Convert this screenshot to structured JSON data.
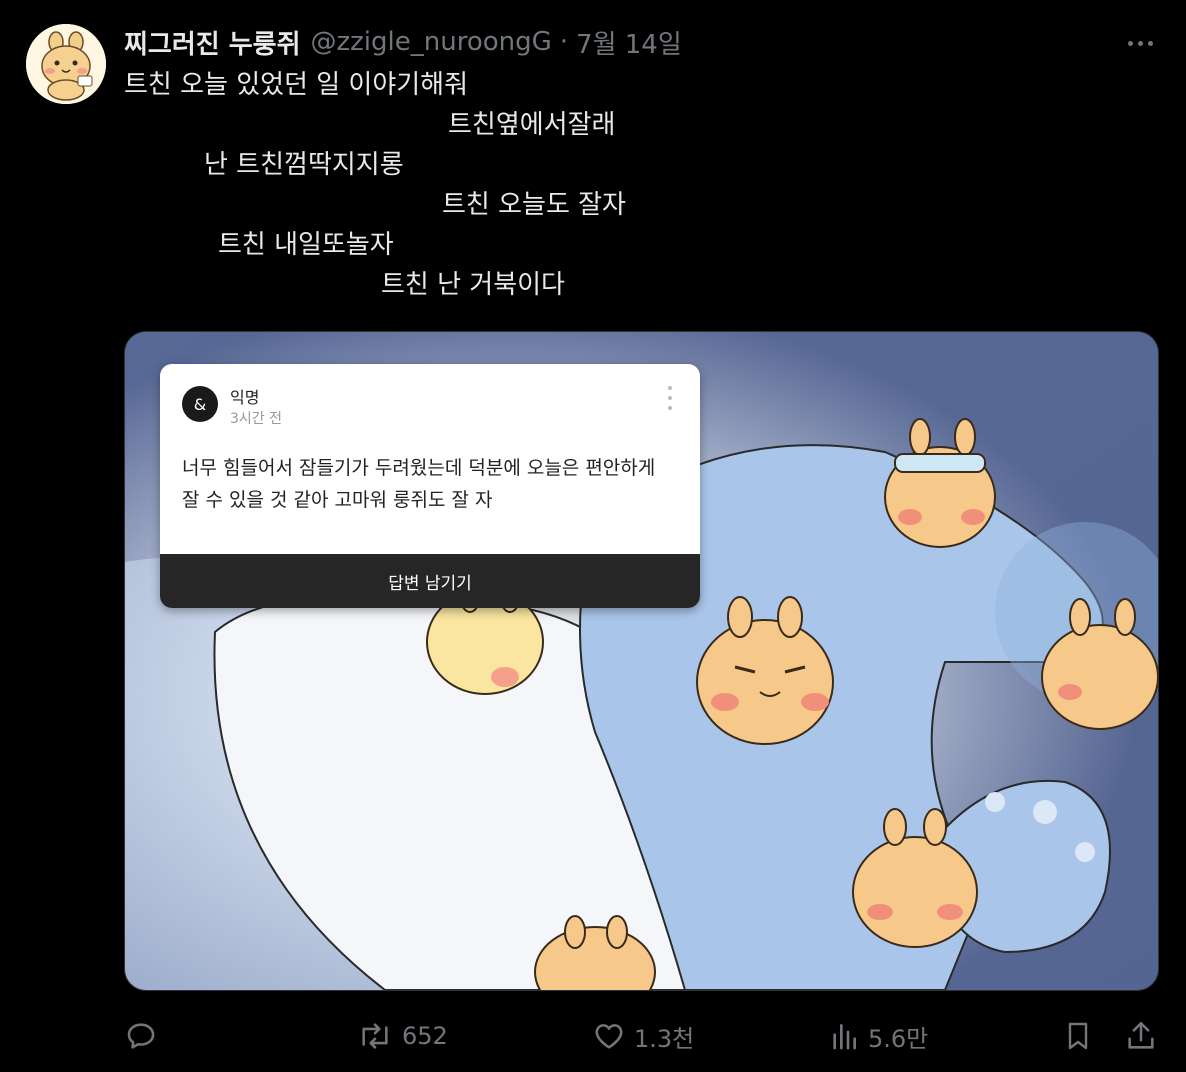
{
  "author": {
    "display_name": "찌그러진 누룽쥐",
    "handle": "@zzigle_nuroongG",
    "separator": "·",
    "date": "7월 14일"
  },
  "tweet_lines": [
    "트친 오늘 있었던 일 이야기해줘",
    "트친옆에서잘래",
    "난 트친껌딱지지롱",
    "트친 오늘도 잘자",
    "트친 내일또놀자",
    "트친 난 거북이다"
  ],
  "embedded_card": {
    "avatar_glyph": "&",
    "name": "익명",
    "time": "3시간 전",
    "body": "너무 힘들어서 잠들기가 두려웠는데 덕분에 오늘은 편안하게 잘 수 있을 것 같아 고마워 룽쥐도 잘 자",
    "button_label": "답변 남기기"
  },
  "actions": {
    "replies": "",
    "retweets": "652",
    "likes": "1.3천",
    "views": "5.6만"
  },
  "colors": {
    "background": "#000000",
    "text": "#e7e9ea",
    "muted": "#71767b",
    "border": "#2f3336"
  },
  "icons": [
    "more-icon",
    "reply-icon",
    "retweet-icon",
    "like-icon",
    "views-icon",
    "bookmark-icon",
    "share-icon"
  ]
}
